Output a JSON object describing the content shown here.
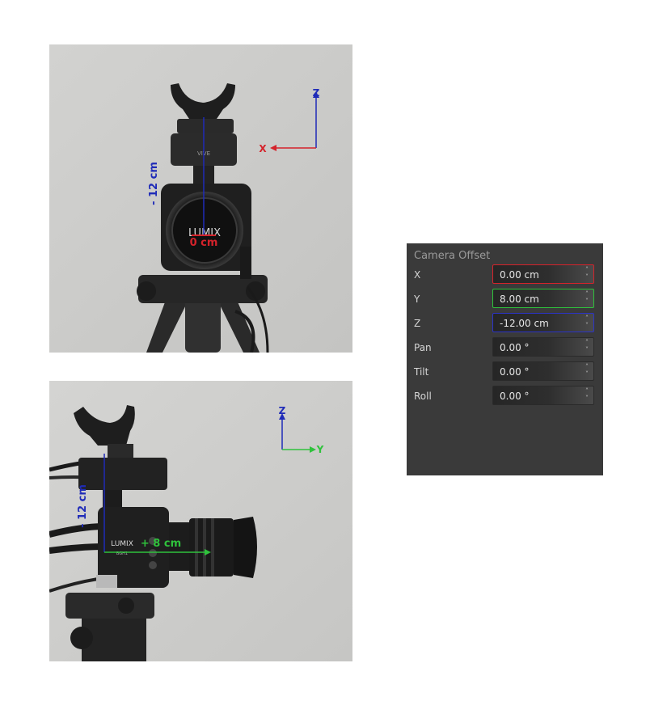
{
  "front_photo": {
    "axis_z": "Z",
    "axis_x": "X",
    "offset_vertical": "- 12 cm",
    "offset_horizontal": "0 cm",
    "vive_text": "VIVE",
    "lumix_text": "LUMIX",
    "colors": {
      "x_axis": "#d4232b",
      "z_axis": "#1f2bb8"
    }
  },
  "side_photo": {
    "axis_z": "Z",
    "axis_y": "Y",
    "offset_vertical": "- 12 cm",
    "offset_horizontal": "+ 8 cm",
    "lumix_text": "LUMIX",
    "model_text": "BGH1",
    "colors": {
      "y_axis": "#2fc23c",
      "z_axis": "#1f2bb8"
    }
  },
  "camera_offset": {
    "title": "Camera Offset",
    "rows": [
      {
        "label": "X",
        "value": "0.00 cm",
        "highlight": "#d4232b"
      },
      {
        "label": "Y",
        "value": "8.00 cm",
        "highlight": "#2fc23c"
      },
      {
        "label": "Z",
        "value": "-12.00 cm",
        "highlight": "#2b33c6"
      },
      {
        "label": "Pan",
        "value": "0.00 °"
      },
      {
        "label": "Tilt",
        "value": "0.00 °"
      },
      {
        "label": "Roll",
        "value": "0.00 °"
      }
    ],
    "spin_up_icon": "chevron-up-icon",
    "spin_down_icon": "chevron-down-icon"
  }
}
